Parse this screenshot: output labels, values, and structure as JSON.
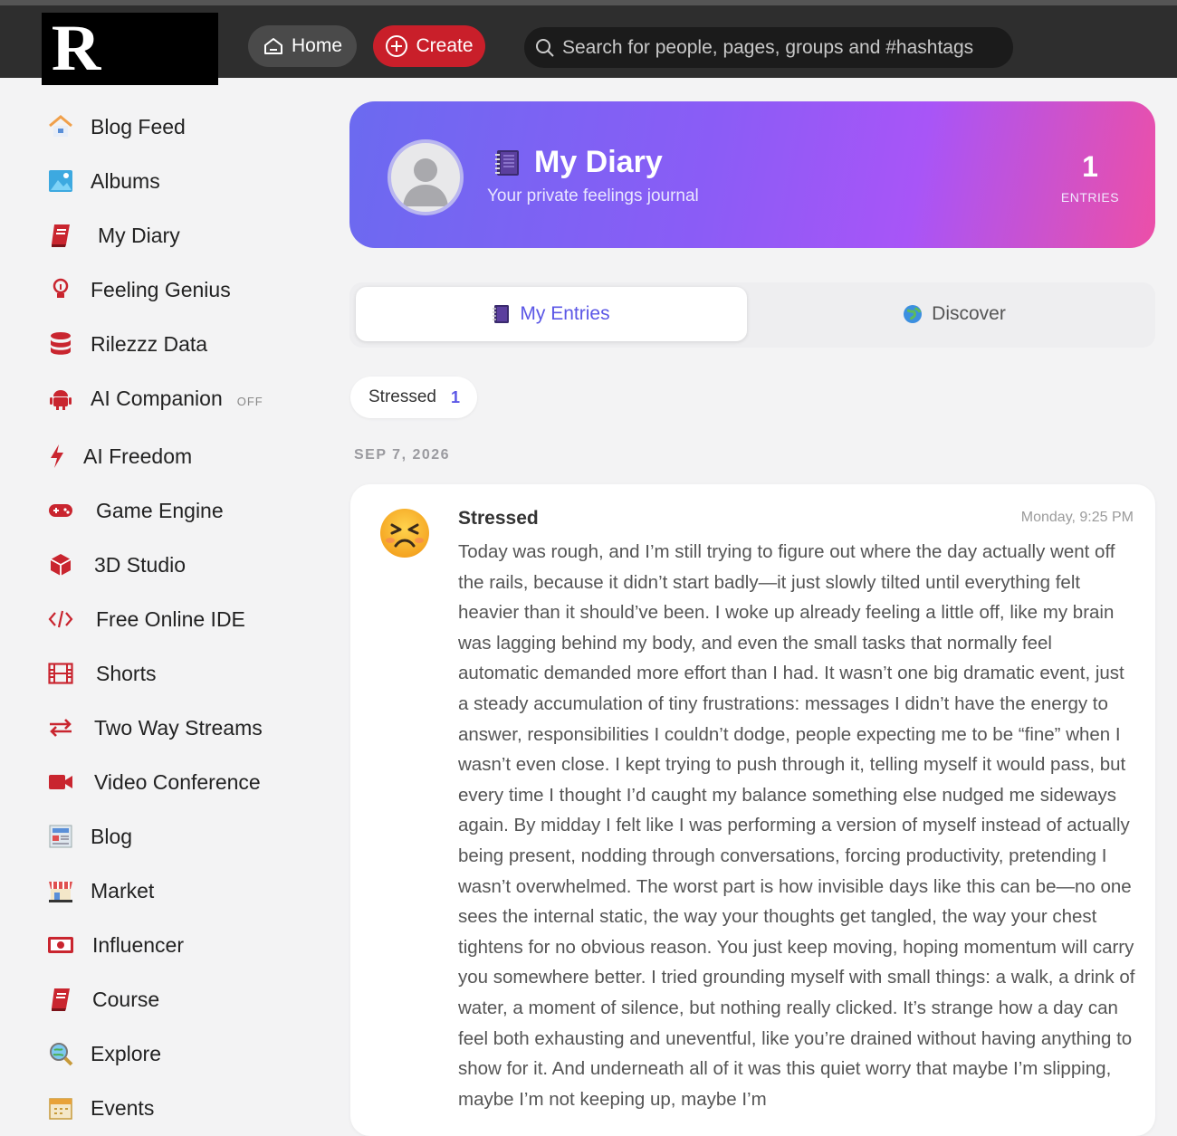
{
  "topbar": {
    "logo_text": "R",
    "home_label": "Home",
    "create_label": "Create",
    "search_placeholder": "Search for people, pages, groups and #hashtags"
  },
  "sidebar": {
    "items": [
      {
        "label": "Blog Feed",
        "icon": "house-icon"
      },
      {
        "label": "Albums",
        "icon": "image-icon"
      },
      {
        "label": "My Diary",
        "icon": "book-icon"
      },
      {
        "label": "Feeling Genius",
        "icon": "lightbulb-icon"
      },
      {
        "label": "Rilezzz Data",
        "icon": "database-icon"
      },
      {
        "label": "AI Companion",
        "icon": "android-icon",
        "badge": "OFF"
      },
      {
        "label": "AI Freedom",
        "icon": "bolt-icon"
      },
      {
        "label": "Game Engine",
        "icon": "gamepad-icon"
      },
      {
        "label": "3D Studio",
        "icon": "cube-icon"
      },
      {
        "label": "Free Online IDE",
        "icon": "code-icon"
      },
      {
        "label": "Shorts",
        "icon": "film-icon"
      },
      {
        "label": "Two Way Streams",
        "icon": "exchange-icon"
      },
      {
        "label": "Video Conference",
        "icon": "video-camera-icon"
      },
      {
        "label": "Blog",
        "icon": "newspaper-icon"
      },
      {
        "label": "Market",
        "icon": "store-icon"
      },
      {
        "label": "Influencer",
        "icon": "money-bill-icon"
      },
      {
        "label": "Course",
        "icon": "book-icon"
      },
      {
        "label": "Explore",
        "icon": "magnifier-globe-icon"
      },
      {
        "label": "Events",
        "icon": "calendar-icon"
      }
    ]
  },
  "hero": {
    "title": "My Diary",
    "subtitle": "Your private feelings journal",
    "count": "1",
    "count_label": "ENTRIES"
  },
  "tabs": {
    "my_entries": "My Entries",
    "discover": "Discover"
  },
  "filter": {
    "label": "Stressed",
    "count": "1"
  },
  "entries": [
    {
      "date": "SEP 7, 2026",
      "mood": "Stressed",
      "time": "Monday, 9:25 PM",
      "text": "Today was rough, and I’m still trying to figure out where the day actually went off the rails, because it didn’t start badly—it just slowly tilted until everything felt heavier than it should’ve been. I woke up already feeling a little off, like my brain was lagging behind my body, and even the small tasks that normally feel automatic demanded more effort than I had. It wasn’t one big dramatic event, just a steady accumulation of tiny frustrations: messages I didn’t have the energy to answer, responsibilities I couldn’t dodge, people expecting me to be “fine” when I wasn’t even close. I kept trying to push through it, telling myself it would pass, but every time I thought I’d caught my balance something else nudged me sideways again. By midday I felt like I was performing a version of myself instead of actually being present, nodding through conversations, forcing productivity, pretending I wasn’t overwhelmed. The worst part is how invisible days like this can be—no one sees the internal static, the way your thoughts get tangled, the way your chest tightens for no obvious reason. You just keep moving, hoping momentum will carry you somewhere better. I tried grounding myself with small things: a walk, a drink of water, a moment of silence, but nothing really clicked. It’s strange how a day can feel both exhausting and uneventful, like you’re drained without having anything to show for it. And underneath all of it was this quiet worry that maybe I’m slipping, maybe I’m not keeping up, maybe I’m"
    }
  ]
}
